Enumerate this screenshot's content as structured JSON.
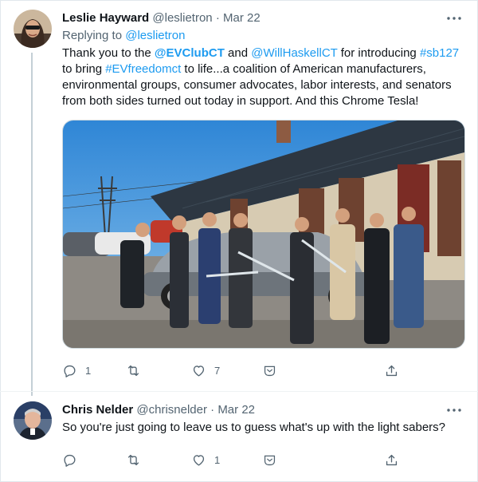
{
  "tweet1": {
    "name": "Leslie Hayward",
    "handle": "@leslietron",
    "dot": "·",
    "date": "Mar 22",
    "replying_prefix": "Replying to ",
    "replying_to": "@leslietron",
    "text": {
      "p1": "Thank you to the ",
      "m1": "@EVClubCT",
      "p2": " and ",
      "m2": "@WillHaskellCT",
      "p3": " for introducing ",
      "h1": "#sb127",
      "p4": " to bring ",
      "h2": "#EVfreedomct",
      "p5": " to life...a coalition of American manufacturers, environmental groups, consumer advocates, labor interests, and senators from both sides turned out today in support. And this Chrome Tesla!"
    },
    "actions": {
      "reply_count": "1",
      "retweet_count": "",
      "like_count": "7"
    }
  },
  "tweet2": {
    "name": "Chris Nelder",
    "handle": "@chrisnelder",
    "dot": "·",
    "date": "Mar 22",
    "text": "So you're just going to leave us to guess what's up with the light sabers?",
    "actions": {
      "reply_count": "",
      "retweet_count": "",
      "like_count": "1"
    }
  },
  "icons": {
    "more": "more-horizontal-icon",
    "reply": "reply-icon",
    "retweet": "retweet-icon",
    "like": "heart-icon",
    "share_dm": "share-dm-icon",
    "share": "share-upload-icon"
  },
  "colors": {
    "link": "#1d9bf0",
    "muted": "#536471",
    "text": "#0f1419",
    "sky": "#5aa8e6",
    "roof": "#2f3a44"
  }
}
